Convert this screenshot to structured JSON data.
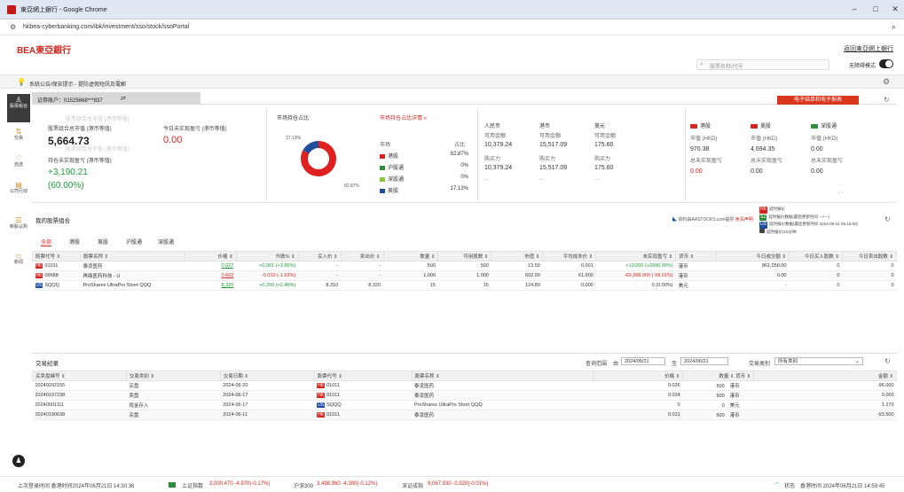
{
  "browser": {
    "tab_title": "東亞網上銀行 - Google Chrome",
    "url": "hkbea-cyberbanking.com/ibk/investment/sso/stock/ssoPortal",
    "minimize": "–",
    "maximize": "□",
    "close": "✕"
  },
  "header": {
    "logo": "BEA東亞銀行",
    "back_link": "返回東亞網上銀行",
    "search_placeholder": "股票名称/代号",
    "hide_mode_label": "无障碍模式"
  },
  "notice": {
    "text": "系統公告/保安提示 - 提防虛假短訊及電郵"
  },
  "sidebar": {
    "items": [
      {
        "label": "股票组合",
        "icon": "person-icon"
      },
      {
        "label": "交易",
        "icon": "swap-icon"
      },
      {
        "label": "自选",
        "icon": "heart-icon"
      },
      {
        "label": "公司行动",
        "icon": "document-icon"
      },
      {
        "label": "新股认购",
        "icon": "stack-icon"
      },
      {
        "label": "新闻",
        "icon": "news-icon"
      }
    ]
  },
  "account": {
    "label": "证券账户：01525668***837",
    "switch_icon": "⇄",
    "red_button": "电子结单和电子报表"
  },
  "summary": {
    "watermark1": "股票组合总市值 (港币等值)",
    "watermark2": "股票组合总市值 (港币等值)",
    "market_value_label": "股票组合总市值 (港币等值)",
    "market_value": "5,664.73",
    "today_pnl_label": "今日未实现盈亏 (港币等值)",
    "today_pnl": "0.00",
    "holding_pnl_label": "持仓未实现盈亏 (港币等值)",
    "holding_pnl": "+3,190.21",
    "holding_pnl_pct": "(60.00%)"
  },
  "allocation": {
    "title": "市场持仓占比",
    "detail_link": "市场持仓占比详情 »",
    "label_small": "17.13%",
    "label_big": "82.87%",
    "col_market": "市场",
    "col_pct": "占比",
    "rows": [
      {
        "market": "港股",
        "pct": "82.87%",
        "color": "#e02020"
      },
      {
        "market": "沪股通",
        "pct": "0%",
        "color": "#2e8b3a"
      },
      {
        "market": "深股通",
        "pct": "0%",
        "color": "#8cc63f"
      },
      {
        "market": "美股",
        "pct": "17.13%",
        "color": "#1f4e9c"
      }
    ]
  },
  "cash": {
    "currencies": [
      "人民币",
      "港币",
      "美元"
    ],
    "available_label": "可用金额",
    "available": [
      "10,379.24",
      "15,517.09",
      "175.60"
    ],
    "buying_label": "购买力",
    "buying": [
      "10,379.24",
      "15,517.09",
      "175.60"
    ],
    "more": "..."
  },
  "markets": {
    "cols": [
      {
        "tag": "HK",
        "tag_color": "#d6251e",
        "name": "港股",
        "mv_label": "市值 (HKD)",
        "mv": "970.38",
        "pnl_label": "总未实现盈亏",
        "pnl": "0.00",
        "pnl_red": true
      },
      {
        "tag": "US",
        "tag_color": "#d6251e",
        "name": "美股",
        "mv_label": "市值 (HKD)",
        "mv": "4,694.35",
        "pnl_label": "总未实现盈亏",
        "pnl": "0.00",
        "pnl_red": false
      },
      {
        "tag": "SZ",
        "tag_color": "#2e8b3a",
        "name": "深股通",
        "mv_label": "市值 (HKD)",
        "mv": "0.00",
        "pnl_label": "总未实现盈亏",
        "pnl": "0.00",
        "pnl_red": false
      }
    ]
  },
  "portfolio": {
    "title": "我的股票组合",
    "aastocks": "资料由AASTOCKS.com提供",
    "aastocks_link": "免责声明",
    "legend": [
      {
        "tag": "HK",
        "color": "#d6251e",
        "text": "延时报价"
      },
      {
        "tag": "SZ",
        "color": "#2e8b3a",
        "text": "延时报价数据(最后更新时间 ---/---)"
      },
      {
        "tag": "US",
        "color": "#1f4e9c",
        "text": "延时报价数据(最后更新时间 2024-06-21 06:16:00)"
      },
      {
        "tag": "",
        "color": "#444",
        "text": "延时报价(15分钟"
      }
    ],
    "tabs": [
      "全部",
      "港股",
      "美股",
      "沪股通",
      "深股通"
    ],
    "columns": [
      "股票代号 ⇕",
      "股票名称 ⇕",
      "价格 ⇕",
      "升跌% ⇕",
      "买入价 ⇕",
      "卖出价 ⇕",
      "数量 ⇕",
      "可用股数 ⇕",
      "市值 ⇕",
      "平均成本价 ⇕",
      "未实现盈亏 ⇕",
      "货币 ⇕",
      "今日成交额 ⇕",
      "今日买入股数 ⇕",
      "今日卖出股数 ⇕"
    ],
    "rows": [
      {
        "tag": "HK",
        "tagc": "#d6251e",
        "code": "01011",
        "name": "泰凌医药",
        "price": "0.027",
        "chg": "+0.001 (+3.85%)",
        "chgc": "pos",
        "bid": "-",
        "ask": "-",
        "qty": "500",
        "avail": "500",
        "mv": "13.50",
        "cost": "0.001",
        "pnl": "+13.000 (+2600.00%)",
        "pnlc": "pos",
        "ccy": "港币",
        "turn": "861,050.00",
        "buy": "0",
        "sell": "0"
      },
      {
        "tag": "HK",
        "tagc": "#d6251e",
        "code": "09688",
        "name": "再鼎医药科技 - U",
        "price": "0.602",
        "chg": "-0.010 (-1.63%)",
        "chgc": "neg",
        "bid": "-",
        "ask": "-",
        "qty": "1,000",
        "avail": "1,000",
        "mv": "602.00",
        "cost": "61.000",
        "pnl": "-60,398.000 (-99.01%)",
        "pnlc": "neg",
        "ccy": "港币",
        "turn": "0.00",
        "buy": "0",
        "sell": "0"
      },
      {
        "tag": "US",
        "tagc": "#1f4e9c",
        "code": "SQQQ",
        "name": "ProShares UltraPro Short QQQ",
        "price": "8.320",
        "chg": "+0.200 (+2.46%)",
        "chgc": "pos",
        "bid": "8.310",
        "ask": "8.320",
        "qty": "15",
        "avail": "15",
        "mv": "124.80",
        "cost": "0.000",
        "pnl": "0 (0.00%)",
        "pnlc": "",
        "ccy": "美元",
        "turn": "-",
        "buy": "0",
        "sell": "0"
      }
    ]
  },
  "trades": {
    "title": "交易纪录",
    "range_label": "查询范围",
    "from_label": "由",
    "from": "2024/05/21",
    "to_label": "至",
    "to": "2024/06/21",
    "type_label": "交易类别",
    "type_value": "所有类别",
    "columns": [
      "买卖盘编号 ⇕",
      "交易类别 ⇕",
      "交易日期 ⇕",
      "股票代号 ⇕",
      "股票名称 ⇕",
      "价格 ⇕",
      "数量 ⇕ 货币 ⇕",
      "金额 ⇕"
    ],
    "rows": [
      {
        "id": "20240202155",
        "type": "买盘",
        "date": "2024-06-20",
        "tag": "HK",
        "tagc": "#d6251e",
        "code": "01011",
        "name": "泰凌医药",
        "price": "0.026",
        "qty": "500",
        "ccy": "港币",
        "amt": "-96.000"
      },
      {
        "id": "20240197238",
        "type": "卖盘",
        "date": "2024-06-17",
        "tag": "HK",
        "tagc": "#d6251e",
        "code": "01011",
        "name": "泰凌医药",
        "price": "0.024",
        "qty": "500",
        "ccy": "港币",
        "amt": "0.000"
      },
      {
        "id": "20240001111",
        "type": "现金存入",
        "date": "2024-06-17",
        "tag": "US",
        "tagc": "#1f4e9c",
        "code": "SQQQ",
        "name": "ProShares UltraPro Short QQQ",
        "price": "0",
        "qty": "0",
        "ccy": "美元",
        "amt": "1.270"
      },
      {
        "id": "20240190638",
        "type": "买盘",
        "date": "2024-06-11",
        "tag": "HK",
        "tagc": "#d6251e",
        "code": "01011",
        "name": "泰凌医药",
        "price": "0.021",
        "qty": "500",
        "ccy": "港币",
        "amt": "-93.500"
      }
    ]
  },
  "status": {
    "last_login": "上次登录时间 香港时间2024年06月21日 14:30:36",
    "sh_label": "上证指数",
    "sh_value": "3,000.470 -4.970(-0.17%)",
    "hs_label": "沪深300",
    "hs_value": "3,498.960 -4.300(-0.12%)",
    "sz_label": "深证成指",
    "sz_value": "9,067.930 -0.920(-0.01%)",
    "state": "状态",
    "time": "香港时间 2024年06月21日 14:59:45"
  }
}
